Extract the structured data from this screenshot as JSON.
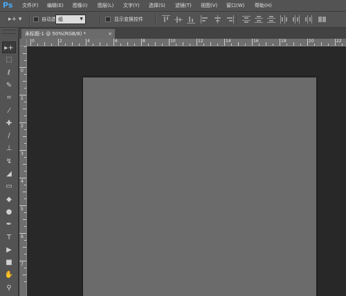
{
  "menubar": {
    "logo": "Ps",
    "items": [
      "文件(F)",
      "编辑(E)",
      "图像(I)",
      "图层(L)",
      "文字(Y)",
      "选择(S)",
      "滤镜(T)",
      "视图(V)",
      "窗口(W)",
      "帮助(H)"
    ]
  },
  "options": {
    "tool_preset": "▸+ ▾",
    "auto_select_label": "自动选择：",
    "auto_select_value": "组",
    "show_transform_label": "显示变换控件"
  },
  "document": {
    "tab_title": "未标题-1 @ 50%(RGB/8) *",
    "tab_close": "×"
  },
  "rulers": {
    "horizontal": [
      "0",
      "2",
      "4",
      "6",
      "8",
      "10",
      "12",
      "14",
      "16",
      "18",
      "20",
      "22"
    ],
    "vertical": [
      "2",
      "0",
      "1",
      "2",
      "3",
      "4",
      "5",
      "6",
      "7"
    ]
  },
  "tools": [
    {
      "icon": "move-icon",
      "glyph": "▸+"
    },
    {
      "icon": "marquee-icon",
      "glyph": "⬚"
    },
    {
      "icon": "lasso-icon",
      "glyph": "ℓ"
    },
    {
      "icon": "quick-select-icon",
      "glyph": "✎"
    },
    {
      "icon": "crop-icon",
      "glyph": "⌗"
    },
    {
      "icon": "eyedropper-icon",
      "glyph": "⁄"
    },
    {
      "icon": "healing-brush-icon",
      "glyph": "✚"
    },
    {
      "icon": "brush-icon",
      "glyph": "∕"
    },
    {
      "icon": "clone-stamp-icon",
      "glyph": "⊥"
    },
    {
      "icon": "history-brush-icon",
      "glyph": "↯"
    },
    {
      "icon": "eraser-icon",
      "glyph": "◢"
    },
    {
      "icon": "gradient-icon",
      "glyph": "▭"
    },
    {
      "icon": "blur-icon",
      "glyph": "◆"
    },
    {
      "icon": "dodge-icon",
      "glyph": "●"
    },
    {
      "icon": "pen-icon",
      "glyph": "✒"
    },
    {
      "icon": "type-icon",
      "glyph": "T"
    },
    {
      "icon": "path-select-icon",
      "glyph": "▶"
    },
    {
      "icon": "shape-icon",
      "glyph": "■"
    },
    {
      "icon": "hand-icon",
      "glyph": "✋"
    },
    {
      "icon": "zoom-icon",
      "glyph": "⚲"
    }
  ]
}
